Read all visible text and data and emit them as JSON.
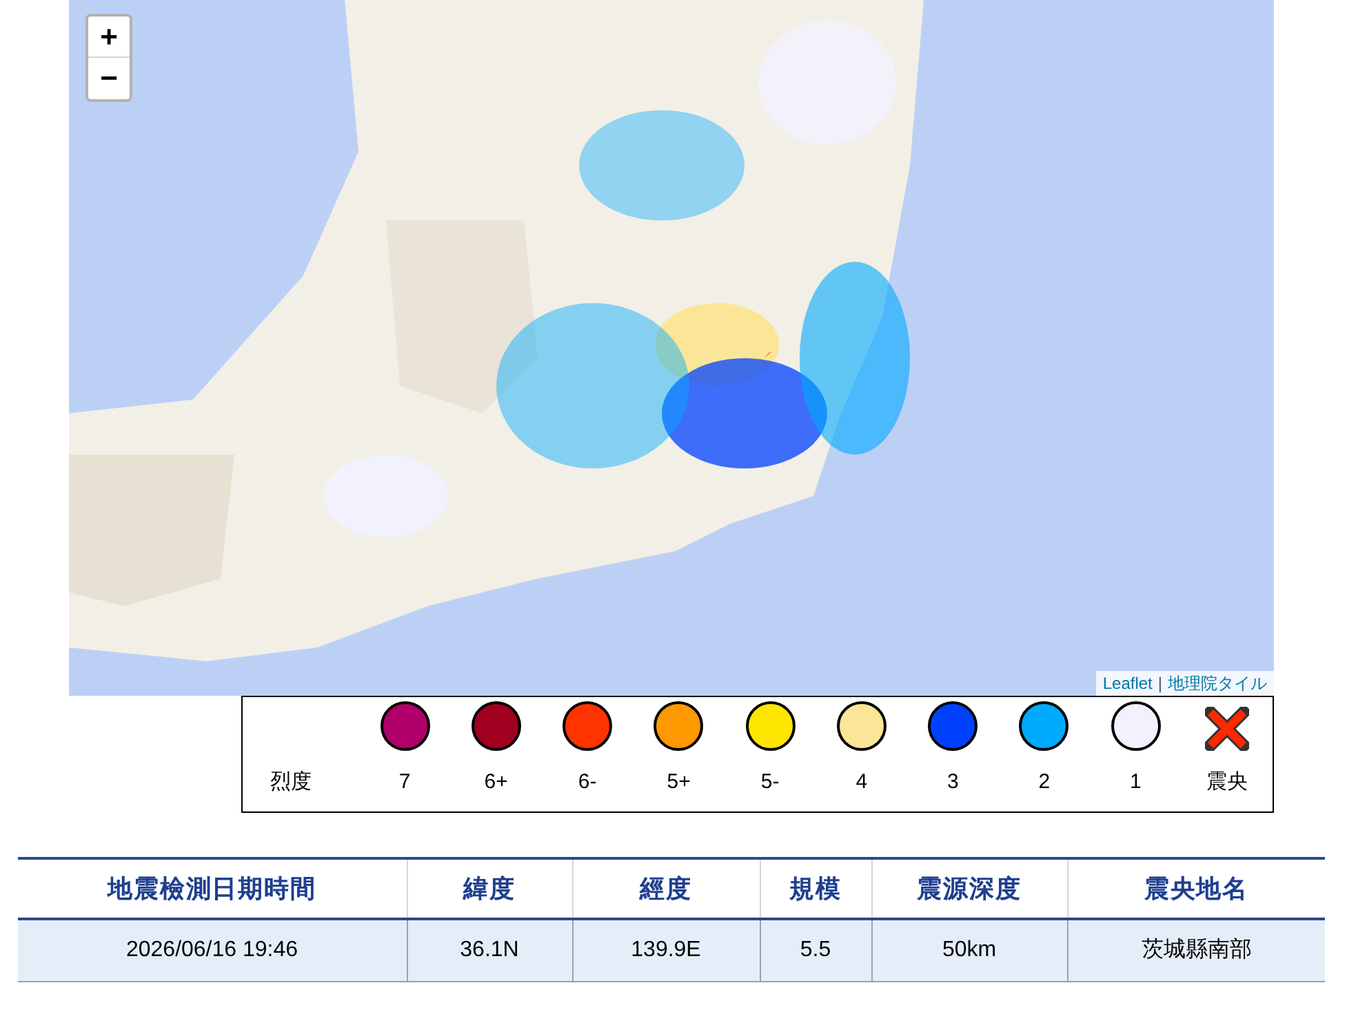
{
  "map": {
    "zoom_in": "+",
    "zoom_out": "−",
    "attribution": [
      {
        "text": "Leaflet"
      },
      {
        "text": "地理院タイル"
      }
    ],
    "separator": "|"
  },
  "legend": {
    "title": "烈度",
    "items": [
      {
        "label": "7",
        "kind": "dot",
        "color": "#b0006a"
      },
      {
        "label": "6+",
        "kind": "dot",
        "color": "#a00020"
      },
      {
        "label": "6-",
        "kind": "dot",
        "color": "#ff3300"
      },
      {
        "label": "5+",
        "kind": "dot",
        "color": "#ff9900"
      },
      {
        "label": "5-",
        "kind": "dot",
        "color": "#ffe600"
      },
      {
        "label": "4",
        "kind": "dot",
        "color": "#fae696"
      },
      {
        "label": "3",
        "kind": "dot",
        "color": "#0041ff"
      },
      {
        "label": "2",
        "kind": "dot",
        "color": "#00aaff"
      },
      {
        "label": "1",
        "kind": "dot",
        "color": "#f2f2ff"
      },
      {
        "label": "震央",
        "kind": "cross",
        "color": "#ff2800"
      }
    ]
  },
  "table": {
    "columns": [
      "地震檢測日期時間",
      "緯度",
      "經度",
      "規模",
      "震源深度",
      "震央地名"
    ],
    "rows": [
      [
        "2026/06/16 19:46",
        "36.1N",
        "139.9E",
        "5.5",
        "50km",
        "茨城縣南部"
      ]
    ]
  }
}
